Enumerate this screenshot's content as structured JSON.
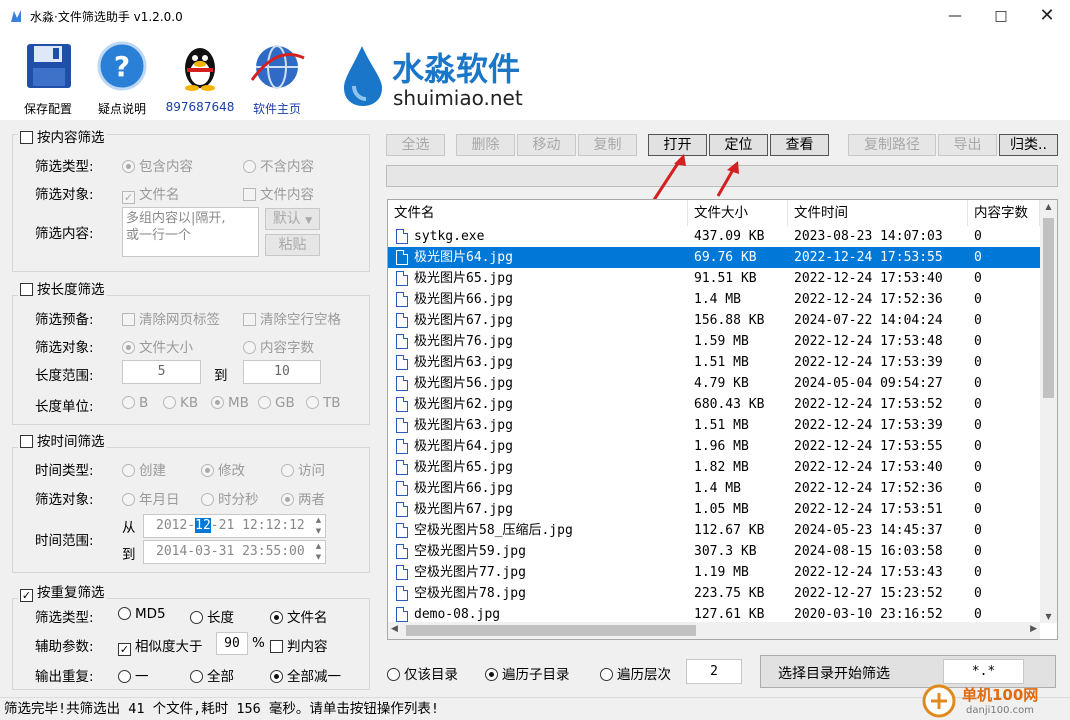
{
  "window": {
    "title": "水淼·文件筛选助手 v1.2.0.0"
  },
  "toolbar": {
    "items": [
      {
        "label": "保存配置",
        "icon": "floppy-disk-icon"
      },
      {
        "label": "疑点说明",
        "icon": "question-icon"
      },
      {
        "label": "897687648",
        "icon": "qq-penguin-icon"
      },
      {
        "label": "软件主页",
        "icon": "globe-icon"
      }
    ],
    "brand_cn": "水淼软件",
    "brand_en": "shuimiao.net"
  },
  "content_filter": {
    "title": "按内容筛选",
    "type_label": "筛选类型:",
    "type_options": [
      "包含内容",
      "不含内容"
    ],
    "target_label": "筛选对象:",
    "target_options": [
      "文件名",
      "文件内容"
    ],
    "content_label": "筛选内容:",
    "content_placeholder": "多组内容以|隔开,\n或一行一个",
    "default_label": "默认",
    "paste_label": "粘贴"
  },
  "length_filter": {
    "title": "按长度筛选",
    "preset_label": "筛选预备:",
    "preset_options": [
      "清除网页标签",
      "清除空行空格"
    ],
    "target_label": "筛选对象:",
    "target_options": [
      "文件大小",
      "内容字数"
    ],
    "range_label": "长度范围:",
    "range_from": "5",
    "range_to_label": "到",
    "range_to": "10",
    "unit_label": "长度单位:",
    "units": [
      "B",
      "KB",
      "MB",
      "GB",
      "TB"
    ]
  },
  "time_filter": {
    "title": "按时间筛选",
    "type_label": "时间类型:",
    "type_options": [
      "创建",
      "修改",
      "访问"
    ],
    "target_label": "筛选对象:",
    "target_options": [
      "年月日",
      "时分秒",
      "两者"
    ],
    "range_label": "时间范围:",
    "from_label": "从",
    "from_pre": "2012-",
    "from_sel": "12",
    "from_post": "-21 12:12:12",
    "to_label": "到",
    "to_value": "2014-03-31 23:55:00"
  },
  "dup_filter": {
    "title": "按重复筛选",
    "type_label": "筛选类型:",
    "type_options": [
      "MD5",
      "长度",
      "文件名"
    ],
    "aux_label": "辅助参数:",
    "similarity_label": "相似度大于",
    "similarity_value": "90",
    "percent": "%",
    "judge_label": "判内容",
    "output_label": "输出重复:",
    "output_options": [
      "一",
      "全部",
      "全部减一"
    ]
  },
  "actions": {
    "select_all": "全选",
    "delete": "删除",
    "move": "移动",
    "copy": "复制",
    "open": "打开",
    "locate": "定位",
    "view": "查看",
    "copy_path": "复制路径",
    "export": "导出",
    "categorize": "归类.."
  },
  "table": {
    "columns": [
      "文件名",
      "文件大小",
      "文件时间",
      "内容字数"
    ],
    "rows": [
      [
        "sytkg.exe",
        "437.09 KB",
        "2023-08-23 14:07:03",
        "0"
      ],
      [
        "极光图片64.jpg",
        "69.76 KB",
        "2022-12-24 17:53:55",
        "0"
      ],
      [
        "极光图片65.jpg",
        "91.51 KB",
        "2022-12-24 17:53:40",
        "0"
      ],
      [
        "极光图片66.jpg",
        "1.4 MB",
        "2022-12-24 17:52:36",
        "0"
      ],
      [
        "极光图片67.jpg",
        "156.88 KB",
        "2024-07-22 14:04:24",
        "0"
      ],
      [
        "极光图片76.jpg",
        "1.59 MB",
        "2022-12-24 17:53:48",
        "0"
      ],
      [
        "极光图片63.jpg",
        "1.51 MB",
        "2022-12-24 17:53:39",
        "0"
      ],
      [
        "极光图片56.jpg",
        "4.79 KB",
        "2024-05-04 09:54:27",
        "0"
      ],
      [
        "极光图片62.jpg",
        "680.43 KB",
        "2022-12-24 17:53:52",
        "0"
      ],
      [
        "极光图片63.jpg",
        "1.51 MB",
        "2022-12-24 17:53:39",
        "0"
      ],
      [
        "极光图片64.jpg",
        "1.96 MB",
        "2022-12-24 17:53:55",
        "0"
      ],
      [
        "极光图片65.jpg",
        "1.82 MB",
        "2022-12-24 17:53:40",
        "0"
      ],
      [
        "极光图片66.jpg",
        "1.4 MB",
        "2022-12-24 17:52:36",
        "0"
      ],
      [
        "极光图片67.jpg",
        "1.05 MB",
        "2022-12-24 17:53:51",
        "0"
      ],
      [
        "空极光图片58_压缩后.jpg",
        "112.67 KB",
        "2024-05-23 14:45:37",
        "0"
      ],
      [
        "空极光图片59.jpg",
        "307.3 KB",
        "2024-08-15 16:03:58",
        "0"
      ],
      [
        "空极光图片77.jpg",
        "1.19 MB",
        "2022-12-24 17:53:43",
        "0"
      ],
      [
        "空极光图片78.jpg",
        "223.75 KB",
        "2022-12-27 15:23:52",
        "0"
      ],
      [
        "demo-08.jpg",
        "127.61 KB",
        "2020-03-10 23:16:52",
        "0"
      ]
    ],
    "selected_index": 1
  },
  "scan": {
    "options": [
      "仅该目录",
      "遍历子目录",
      "遍历层次"
    ],
    "depth": "2",
    "start_label": "选择目录开始筛选",
    "pattern": "*.*"
  },
  "status": "筛选完毕!共筛选出 41 个文件,耗时 156 毫秒。请单击按钮操作列表!",
  "watermark": {
    "text": "单机100网",
    "url": "danji100.com"
  },
  "colors": {
    "selection": "#0078d7",
    "arrow": "#d42020",
    "brand_blue": "#1a76c8"
  }
}
